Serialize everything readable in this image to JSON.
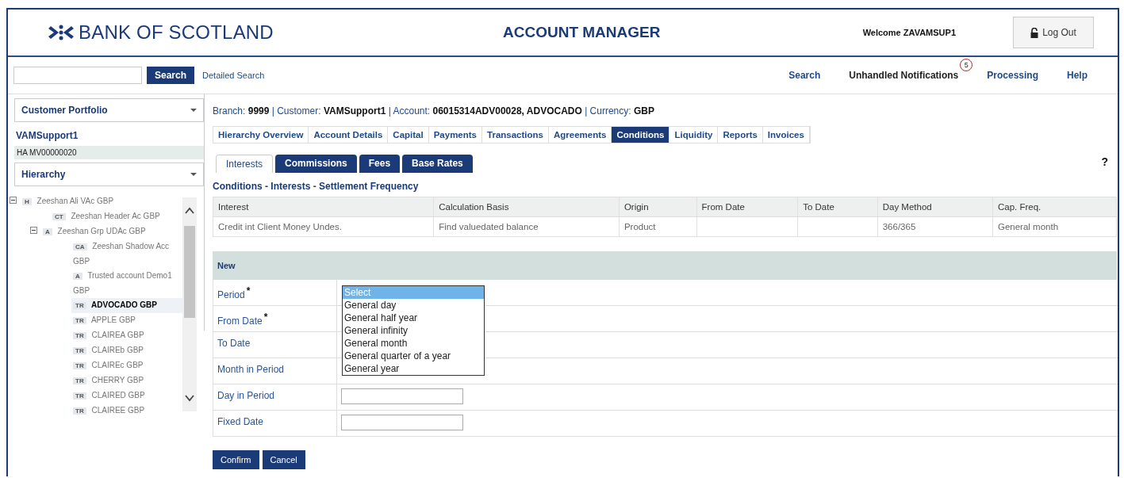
{
  "header": {
    "brand": "BANK OF SCOTLAND",
    "title": "ACCOUNT MANAGER",
    "welcome": "Welcome ZAVAMSUP1",
    "logout": "Log Out"
  },
  "nav": {
    "search_button": "Search",
    "detailed_search": "Detailed Search",
    "links": [
      {
        "label": "Search"
      },
      {
        "label": "Unhandled Notifications",
        "badge": "5"
      },
      {
        "label": "Processing"
      },
      {
        "label": "Help"
      }
    ]
  },
  "sidebar": {
    "portfolio_title": "Customer Portfolio",
    "customer": "VAMSupport1",
    "items": [
      {
        "label": "HA MV00000020",
        "selected": true
      }
    ],
    "hierarchy_title": "Hierarchy",
    "tree": [
      {
        "tag": "H",
        "label": "Zeeshan Ali VAc GBP",
        "expanded": true,
        "selected": false,
        "children": [
          {
            "tag": "CT",
            "label": "Zeeshan Header Ac GBP",
            "selected": false
          },
          {
            "tag": "A",
            "label": "Zeeshan Grp UDAc GBP",
            "expanded": true,
            "selected": false,
            "children": [
              {
                "tag": "CA",
                "label": "Zeeshan Shadow Acc GBP",
                "selected": false
              },
              {
                "tag": "A",
                "label": "Trusted account Demo1 GBP",
                "selected": false
              },
              {
                "tag": "TR",
                "label": "ADVOCADO GBP",
                "selected": true
              },
              {
                "tag": "TR",
                "label": "APPLE GBP",
                "selected": false
              },
              {
                "tag": "TR",
                "label": "CLAIREA GBP",
                "selected": false
              },
              {
                "tag": "TR",
                "label": "CLAIREb GBP",
                "selected": false
              },
              {
                "tag": "TR",
                "label": "CLAIREc GBP",
                "selected": false
              },
              {
                "tag": "TR",
                "label": "CHERRY GBP",
                "selected": false
              },
              {
                "tag": "TR",
                "label": "CLAIRED GBP",
                "selected": false
              },
              {
                "tag": "TR",
                "label": "CLAIREE GBP",
                "selected": false
              }
            ]
          }
        ]
      }
    ]
  },
  "breadcrumb": "Branch: **9999** | Customer: **VAMSupport1** | Account: **06015314ADV00028, ADVOCADO** | Currency: **GBP**",
  "tabs": [
    {
      "label": "Hierarchy Overview",
      "selected": false
    },
    {
      "label": "Account Details",
      "selected": false
    },
    {
      "label": "Capital",
      "selected": false
    },
    {
      "label": "Payments",
      "selected": false
    },
    {
      "label": "Transactions",
      "selected": false
    },
    {
      "label": "Agreements",
      "selected": false
    },
    {
      "label": "Conditions",
      "selected": true
    },
    {
      "label": "Liquidity",
      "selected": false
    },
    {
      "label": "Reports",
      "selected": false
    },
    {
      "label": "Invoices",
      "selected": false
    }
  ],
  "subtabs": [
    {
      "label": "Interests",
      "selected": true
    },
    {
      "label": "Commissions",
      "selected": false
    },
    {
      "label": "Fees",
      "selected": false
    },
    {
      "label": "Base Rates",
      "selected": false
    }
  ],
  "help": "?",
  "section_title": "Conditions - Interests - Settlement Frequency",
  "table": {
    "columns": [
      "Interest",
      "Calculation Basis",
      "Origin",
      "From Date",
      "To Date",
      "Day Method",
      "Cap. Freq."
    ],
    "rows": [
      [
        "Credit int Client Money Undes.",
        "Find valuedated balance",
        "Product",
        "",
        "",
        "366/365",
        "General month"
      ]
    ]
  },
  "new_title": "New",
  "form": [
    {
      "label": "Period",
      "required_mark": "*",
      "kind": "select"
    },
    {
      "label": "From Date",
      "required_mark": "*",
      "kind": "covered"
    },
    {
      "label": "To Date",
      "kind": "covered"
    },
    {
      "label": "Month in Period",
      "kind": "covered"
    },
    {
      "label": "Day in Period",
      "kind": "input"
    },
    {
      "label": "Fixed Date",
      "kind": "input"
    }
  ],
  "dropdown": [
    {
      "label": "Select",
      "selected": true
    },
    {
      "label": "General day",
      "selected": false
    },
    {
      "label": "General half year",
      "selected": false
    },
    {
      "label": "General infinity",
      "selected": false
    },
    {
      "label": "General month",
      "selected": false
    },
    {
      "label": "General quarter of a year",
      "selected": false
    },
    {
      "label": "General year",
      "selected": false
    }
  ],
  "buttons": [
    "Confirm",
    "Cancel"
  ]
}
